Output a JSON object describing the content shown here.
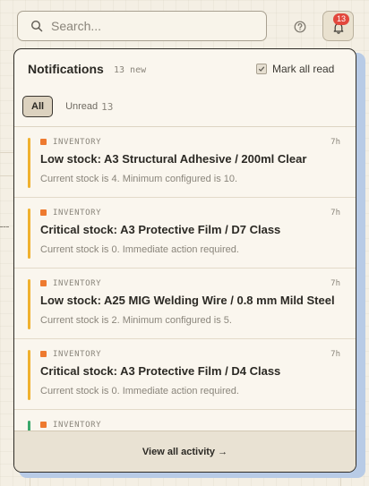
{
  "search": {
    "placeholder": "Search...",
    "value": ""
  },
  "header": {
    "help_icon": "help-circle-icon",
    "bell_icon": "bell-icon",
    "bell_badge": "13"
  },
  "notifications": {
    "title": "Notifications",
    "new_count": "13 new",
    "mark_all_label": "Mark all read",
    "filters": {
      "all_label": "All",
      "unread_label": "Unread",
      "unread_count": "13"
    },
    "items": [
      {
        "category": "INVENTORY",
        "time": "7h",
        "title": "Low stock: A3 Structural Adhesive / 200ml Clear",
        "body": "Current stock is 4. Minimum configured is 10.",
        "bar_color": "#f0b12e",
        "dot_color": "#ee7a2f"
      },
      {
        "category": "INVENTORY",
        "time": "7h",
        "title": "Critical stock: A3 Protective Film / D7 Class",
        "body": "Current stock is 0. Immediate action required.",
        "bar_color": "#f0b12e",
        "dot_color": "#ee7a2f"
      },
      {
        "category": "INVENTORY",
        "time": "7h",
        "title": "Low stock: A25 MIG Welding Wire / 0.8 mm Mild Steel",
        "body": "Current stock is 2. Minimum configured is 5.",
        "bar_color": "#f0b12e",
        "dot_color": "#ee7a2f"
      },
      {
        "category": "INVENTORY",
        "time": "7h",
        "title": "Critical stock: A3 Protective Film / D4 Class",
        "body": "Current stock is 0. Immediate action required.",
        "bar_color": "#f0b12e",
        "dot_color": "#ee7a2f"
      },
      {
        "category": "INVENTORY",
        "time": "",
        "title": "",
        "body": "",
        "bar_color": "#3aa86b",
        "dot_color": "#ee7a2f"
      }
    ],
    "footer_label": "View all activity →"
  }
}
